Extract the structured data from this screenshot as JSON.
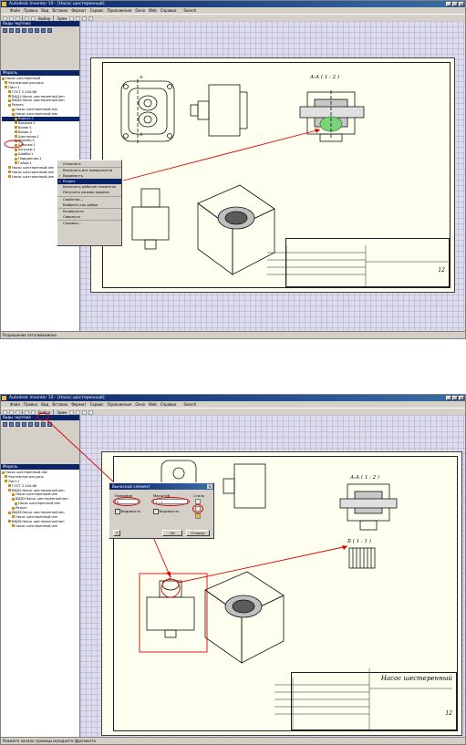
{
  "screen1": {
    "window_title": "Autodesk Inventor 10 - [Насос шестеренный]",
    "menu": [
      "Файл",
      "Правка",
      "Вид",
      "Вставка",
      "Формат",
      "Сервис",
      "Приложения",
      "Окно",
      "Web",
      "Справка"
    ],
    "help_search": "Search",
    "toolbar": {
      "select_label": "Выбор",
      "zoom_label": "Зумм"
    },
    "panel_header": "Виды чертежа",
    "browser_header": "Модель",
    "tree": [
      "Насос шестеренный",
      "Чертежные ресурсы",
      "Лист:1",
      "ГОСТ 2.104-68",
      "ВИД1:Насос шестеренный.iam",
      "ВИД2:Насос шестеренный.iam",
      "Разрез",
      "Насос шестеренный.iam",
      "Насос шестеренный.iam",
      "Корпус:1",
      "Крышка:1",
      "Валик:1",
      "Валик:2",
      "Шестерня:1",
      "Фланец:1",
      "Шпонка:1",
      "Штуцер:1",
      "Шайба:1",
      "Подшипник:1",
      "Гайка:1",
      "Насос шестеренный.iam",
      "Насос шестеренный.iam",
      "Насос шестеренный.iam"
    ],
    "context_menu": [
      "Отменить",
      "Включить все поверхности",
      "Видимость",
      "Разрез",
      "Включить рабочие элементы",
      "Получить размер модели",
      "Свойства...",
      "Выбрать как ребра",
      "Развернуть",
      "Свернуть",
      "Справка..."
    ],
    "context_highlighted": "Разрез",
    "section_label": "А-А ( 1 : 2 )",
    "cut_marker": "А",
    "sheet_number": "12",
    "status": "Разрешение заголовкомоно"
  },
  "screen2": {
    "window_title": "Autodesk Inventor 10 - [Насос шестеренный]",
    "menu": [
      "Файл",
      "Правка",
      "Вид",
      "Вставка",
      "Формат",
      "Сервис",
      "Приложения",
      "Окно",
      "Web",
      "Справка"
    ],
    "help_search": "Search",
    "toolbar": {
      "select_label": "Выбор",
      "zoom_label": "Зумм"
    },
    "panel_header": "Виды чертежа",
    "browser_header": "Модель",
    "tree": [
      "Насос шестеренный.idw",
      "Чертежные ресурсы",
      "Лист:1",
      "ГОСТ 2.104-68",
      "ВИД1:Насос шестеренный.iam",
      "Насос шестеренный.iam",
      "ВИД2:Насос шестеренный.iam",
      "Насос шестеренный.iam",
      "Разрез",
      "ВИД3:Насос шестеренный.iam",
      "Насос шестеренный.iam",
      "ВИД4:Насос шестеренный.iam",
      "Насос шестеренный.iam"
    ],
    "dialog": {
      "title": "Выносной элемент",
      "name_label": "Название",
      "name_value": "Б",
      "scale_label": "Масштаб",
      "scale_value": "1 : 1",
      "style_label": "Стиль",
      "visibility_label": "Видимость",
      "visibility_label2": "Видимость",
      "ok": "OK",
      "cancel": "Отмена",
      "help": "?"
    },
    "section_label": "А-А ( 1 : 2 )",
    "detail_label": "Б ( 1 : 1 )",
    "detail_marker": "Б",
    "name_stamp": "Насос шестеренный",
    "sheet_number": "12",
    "status": "Укажите начало границы исходного фрагмента."
  }
}
